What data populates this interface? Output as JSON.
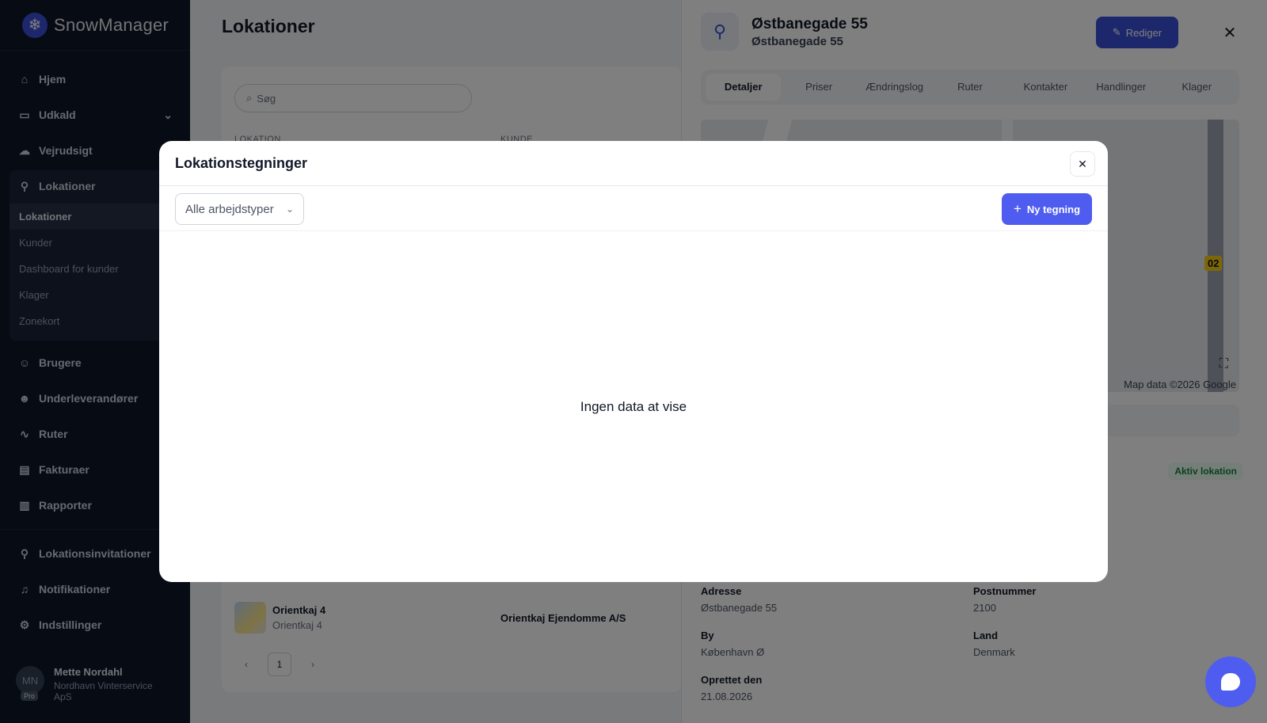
{
  "app": {
    "name": "SnowManager"
  },
  "sidebar": {
    "items": [
      {
        "label": "Hjem"
      },
      {
        "label": "Udkald"
      },
      {
        "label": "Vejrudsigt"
      },
      {
        "label": "Lokationer"
      },
      {
        "label": "Brugere"
      },
      {
        "label": "Underleverandører"
      },
      {
        "label": "Ruter"
      },
      {
        "label": "Fakturaer"
      },
      {
        "label": "Rapporter"
      }
    ],
    "sub_items": [
      {
        "label": "Lokationer"
      },
      {
        "label": "Kunder"
      },
      {
        "label": "Dashboard for kunder"
      },
      {
        "label": "Klager"
      },
      {
        "label": "Zonekort"
      }
    ],
    "bottom_items": [
      {
        "label": "Lokationsinvitationer"
      },
      {
        "label": "Notifikationer"
      },
      {
        "label": "Indstillinger"
      }
    ],
    "user": {
      "initials": "MN",
      "badge": "Pro",
      "name": "Mette Nordahl",
      "company": "Nordhavn Vinterservice ApS"
    }
  },
  "main": {
    "title": "Lokationer",
    "search_placeholder": "Søg",
    "columns": [
      "LOKATION",
      "KUNDE"
    ],
    "row": {
      "name": "Orientkaj 4",
      "address": "Orientkaj 4",
      "customer": "Orientkaj Ejendomme A/S"
    },
    "pager": {
      "prev": "‹",
      "page": "1",
      "next": "›"
    }
  },
  "drawer": {
    "title": "Østbanegade 55",
    "subtitle": "Østbanegade 55",
    "edit_label": "Rediger",
    "tabs": [
      "Detaljer",
      "Priser",
      "Ændringslog",
      "Ruter",
      "Kontakter",
      "Handlinger",
      "Klager"
    ],
    "active_tab": "Detaljer",
    "map_label": "02",
    "map_credit": "Map data ©2026 Google",
    "status_badge": "Aktiv lokation",
    "fields": {
      "adresse": {
        "label": "Adresse",
        "value": "Østbanegade 55"
      },
      "postnummer": {
        "label": "Postnummer",
        "value": "2100"
      },
      "by": {
        "label": "By",
        "value": "København Ø"
      },
      "land": {
        "label": "Land",
        "value": "Denmark"
      },
      "oprettet": {
        "label": "Oprettet den",
        "value": "21.08.2026"
      }
    }
  },
  "modal": {
    "title": "Lokationstegninger",
    "filter_value": "Alle arbejdstyper",
    "new_button": "Ny tegning",
    "empty_text": "Ingen data at vise"
  },
  "colors": {
    "accent": "#4f5cf0",
    "sidebar_bg": "#0f1729"
  }
}
